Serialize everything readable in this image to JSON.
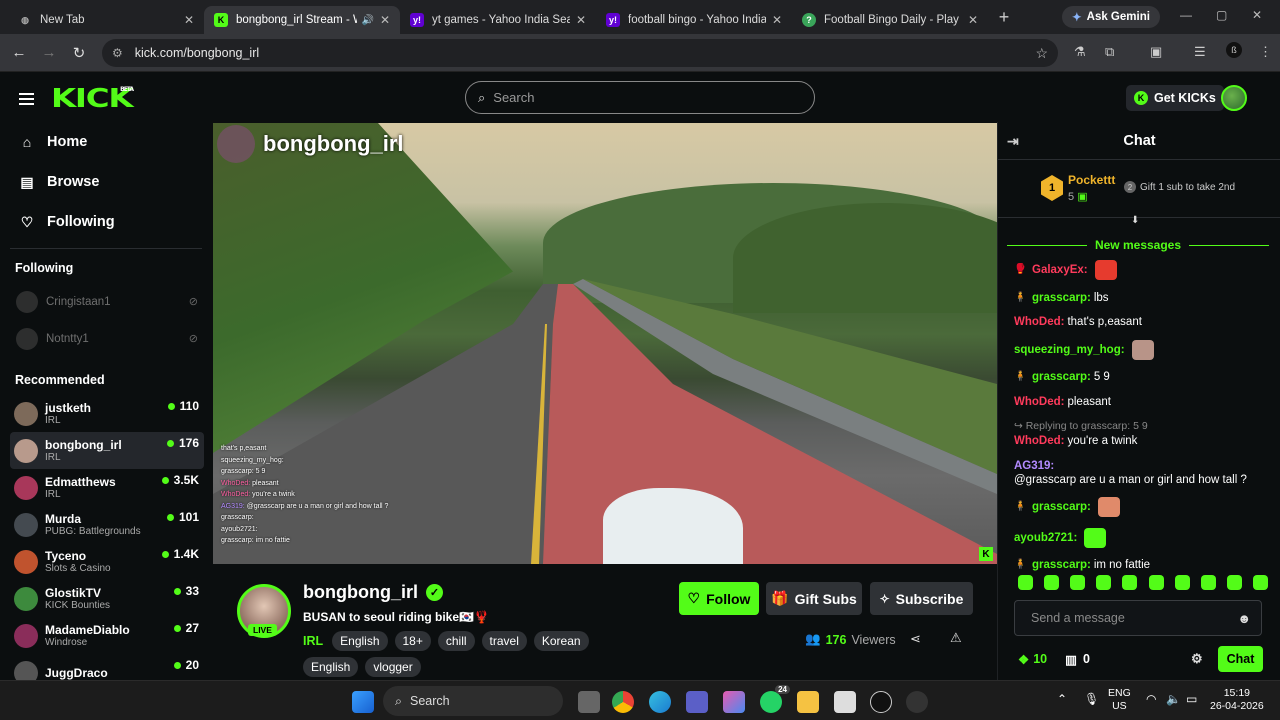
{
  "browser": {
    "tabs": [
      {
        "title": "New Tab",
        "active": false
      },
      {
        "title": "bongbong_irl Stream - Wat",
        "active": true
      },
      {
        "title": "yt games - Yahoo India Search",
        "active": false
      },
      {
        "title": "football bingo - Yahoo India Se",
        "active": false
      },
      {
        "title": "Football Bingo Daily - Play No",
        "active": false
      }
    ],
    "gemini_label": "Ask Gemini",
    "url": "kick.com/bongbong_irl"
  },
  "header": {
    "logo": "KICK",
    "logo_badge": "BETA",
    "search_placeholder": "Search",
    "get_kicks_label": "Get KICKs"
  },
  "sidebar": {
    "nav": [
      {
        "label": "Home",
        "icon": "home-icon"
      },
      {
        "label": "Browse",
        "icon": "browse-icon"
      },
      {
        "label": "Following",
        "icon": "heart-icon"
      }
    ],
    "following_heading": "Following",
    "following": [
      {
        "name": "Cringistaan1"
      },
      {
        "name": "Notntty1"
      }
    ],
    "recommended_heading": "Recommended",
    "recommended": [
      {
        "name": "justketh",
        "category": "IRL",
        "viewers": "110",
        "color": "#7d6a5a"
      },
      {
        "name": "bongbong_irl",
        "category": "IRL",
        "viewers": "176",
        "color": "#b89a8c"
      },
      {
        "name": "Edmatthews",
        "category": "IRL",
        "viewers": "3.5K",
        "color": "#a8375a"
      },
      {
        "name": "Murda",
        "category": "PUBG: Battlegrounds",
        "viewers": "101",
        "color": "#444a50"
      },
      {
        "name": "Tyceno",
        "category": "Slots & Casino",
        "viewers": "1.4K",
        "color": "#c0532e"
      },
      {
        "name": "GlostikTV",
        "category": "KICK Bounties",
        "viewers": "33",
        "color": "#3d8a3d"
      },
      {
        "name": "MadameDiablo",
        "category": "Windrose",
        "viewers": "27",
        "color": "#8a2d5a"
      },
      {
        "name": "JuggDraco",
        "category": "",
        "viewers": "20",
        "color": "#555"
      }
    ]
  },
  "video": {
    "overlay_title": "bongbong_irl",
    "overlay_chat": [
      {
        "user": "",
        "text": "that's p,easant"
      },
      {
        "user": "squeezing_my_hog:",
        "text": ""
      },
      {
        "user": "grasscarp:",
        "text": "5 9"
      },
      {
        "user": "WhoDed:",
        "text": "pleasant"
      },
      {
        "user": "WhoDed:",
        "text": "you're a twink"
      },
      {
        "user": "AG319:",
        "text": "@grasscarp are u a man or girl and how tall ?"
      },
      {
        "user": "grasscarp:",
        "text": ""
      },
      {
        "user": "ayoub2721:",
        "text": ""
      },
      {
        "user": "grasscarp:",
        "text": "im no fattie"
      }
    ]
  },
  "stream": {
    "channel": "bongbong_irl",
    "live_label": "LIVE",
    "title": "BUSAN to seoul riding bike🇰🇷🦞",
    "category": "IRL",
    "tags": [
      "English",
      "18+",
      "chill",
      "travel",
      "Korean",
      "English",
      "vlogger"
    ],
    "follow_label": "Follow",
    "gift_label": "Gift Subs",
    "subscribe_label": "Subscribe",
    "viewers_count": "176",
    "viewers_label": "Viewers"
  },
  "chat": {
    "title": "Chat",
    "pinned": {
      "rank": "1",
      "user": "Pockettt",
      "count": "5",
      "gift_number": "2",
      "gift_text": "Gift 1 sub to take 2nd"
    },
    "new_messages_label": "New messages",
    "messages": [
      {
        "user": "GalaxyEx:",
        "color": "#ff3b5c",
        "text": "",
        "badge": "🥊",
        "emote": "#e63b2e"
      },
      {
        "user": "grasscarp:",
        "color": "#53fc18",
        "text": "lbs",
        "badge": "🧍",
        "emote": ""
      },
      {
        "user": "WhoDed:",
        "color": "#ff3b5c",
        "text": "that's p,easant",
        "badge": "",
        "emote": ""
      },
      {
        "user": "squeezing_my_hog:",
        "color": "#53fc18",
        "text": "",
        "badge": "",
        "emote": "#b89488"
      },
      {
        "user": "grasscarp:",
        "color": "#53fc18",
        "text": "5 9",
        "badge": "🧍",
        "emote": ""
      },
      {
        "user": "WhoDed:",
        "color": "#ff3b5c",
        "text": "pleasant",
        "badge": "",
        "emote": ""
      },
      {
        "reply": "Replying to grasscarp: 5 9",
        "user": "WhoDed:",
        "color": "#ff3b5c",
        "text": "you're a twink",
        "badge": "",
        "emote": ""
      },
      {
        "user": "AG319:",
        "color": "#b38bff",
        "text": "@grasscarp are u a man or girl and how tall ?",
        "badge": "",
        "emote": ""
      },
      {
        "user": "grasscarp:",
        "color": "#53fc18",
        "text": "",
        "badge": "🧍",
        "emote": "#e08a6a"
      },
      {
        "user": "ayoub2721:",
        "color": "#53fc18",
        "text": "",
        "badge": "",
        "emote": "#53fc18"
      },
      {
        "user": "grasscarp:",
        "color": "#53fc18",
        "text": "im no fattie",
        "badge": "🧍",
        "emote": ""
      }
    ],
    "input_placeholder": "Send a message",
    "points": "10",
    "box_count": "0",
    "send_label": "Chat"
  },
  "taskbar": {
    "search_label": "Search",
    "whatsapp_badge": "24",
    "chrome_badge": "6",
    "lang_top": "ENG",
    "lang_bottom": "US",
    "time": "15:19",
    "date": "26-04-2026"
  }
}
